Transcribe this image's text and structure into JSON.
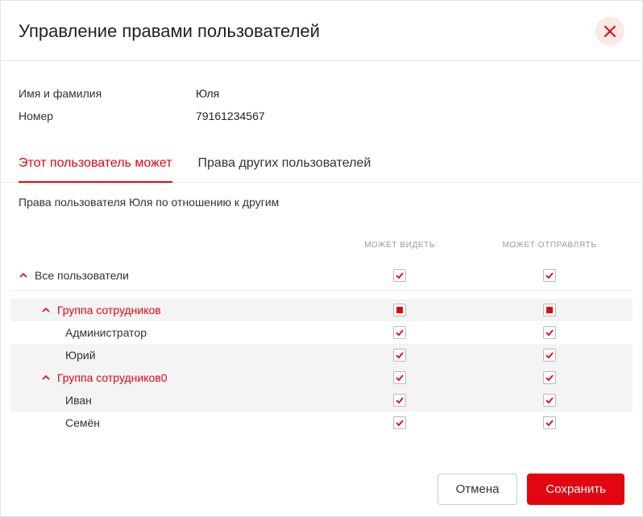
{
  "header": {
    "title": "Управление правами пользователей"
  },
  "info": {
    "name_label": "Имя и фамилия",
    "name_value": "Юля",
    "number_label": "Номер",
    "number_value": "79161234567"
  },
  "tabs": {
    "tab1": "Этот пользователь может",
    "tab2": "Права других пользователей"
  },
  "subtext": "Права пользователя Юля по отношению к другим",
  "columns": {
    "can_see": "МОЖЕТ ВИДЕТЬ",
    "can_send": "МОЖЕТ ОТПРАВЛЯТЬ"
  },
  "rows": {
    "all_users": "Все пользователи",
    "group1": "Группа сотрудников",
    "admin": "Администратор",
    "yuri": "Юрий",
    "group2": "Группа сотрудников0",
    "ivan": "Иван",
    "semen": "Семён"
  },
  "buttons": {
    "cancel": "Отмена",
    "save": "Сохранить"
  }
}
